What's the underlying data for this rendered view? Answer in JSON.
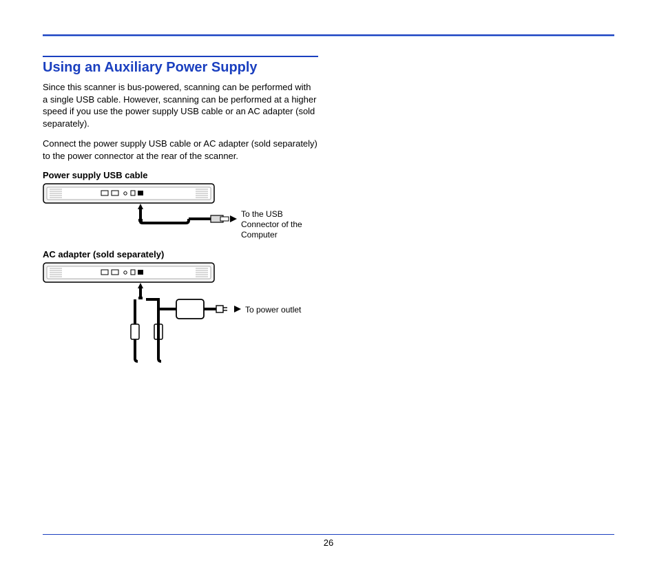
{
  "section": {
    "title": "Using an Auxiliary Power Supply",
    "para1": "Since this scanner is bus-powered, scanning can be performed with a single USB cable. However, scanning can be performed at a higher speed if you use the power supply USB cable or an AC adapter (sold separately).",
    "para2": "Connect the power supply USB cable or AC adapter (sold separately) to the power connector at the rear of the scanner."
  },
  "diagram1": {
    "heading": "Power supply USB cable",
    "callout": "To the USB Connector of the Computer"
  },
  "diagram2": {
    "heading": "AC adapter (sold separately)",
    "callout": "To power outlet"
  },
  "page_number": "26"
}
